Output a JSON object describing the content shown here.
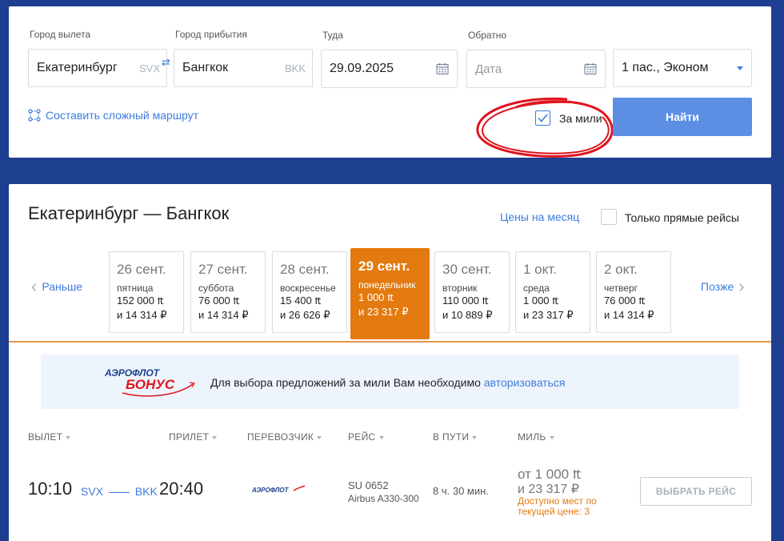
{
  "search": {
    "from_label": "Город вылета",
    "from_value": "Екатеринбург",
    "from_code": "SVX",
    "to_label": "Город прибытия",
    "to_value": "Бангкок",
    "to_code": "BKK",
    "depart_label": "Туда",
    "depart_value": "29.09.2025",
    "return_label": "Обратно",
    "return_placeholder": "Дата",
    "passengers_value": "1 пас., Эконом",
    "complex_route_link": "Составить сложный маршрут",
    "miles_label": "За мили",
    "miles_checked": true,
    "find_button": "Найти",
    "accent_color": "#3d7be0",
    "annotation_color": "#e0141e"
  },
  "results": {
    "title": "Екатеринбург — Бангкок",
    "month_prices_link": "Цены на месяц",
    "direct_only_label": "Только прямые рейсы",
    "direct_only_checked": false,
    "prev_label": "Раньше",
    "next_label": "Позже",
    "days": [
      {
        "date": "26 сент.",
        "weekday": "пятница",
        "miles": "152 000",
        "rub": "и 14 314 ₽"
      },
      {
        "date": "27 сент.",
        "weekday": "суббота",
        "miles": "76 000",
        "rub": "и 14 314 ₽"
      },
      {
        "date": "28 сент.",
        "weekday": "воскресенье",
        "miles": "15 400",
        "rub": "и 26 626 ₽"
      },
      {
        "date": "29 сент.",
        "weekday": "понедельник",
        "miles": "1 000",
        "rub": "и 23 317 ₽",
        "selected": true
      },
      {
        "date": "30 сент.",
        "weekday": "вторник",
        "miles": "110 000",
        "rub": "и 10 889 ₽"
      },
      {
        "date": "1 окт.",
        "weekday": "среда",
        "miles": "1 000",
        "rub": "и 23 317 ₽"
      },
      {
        "date": "2 окт.",
        "weekday": "четверг",
        "miles": "76 000",
        "rub": "и 14 314 ₽"
      }
    ],
    "miles_symbol": "₶",
    "selected_color": "#e37a0f",
    "banner": {
      "logo_line1": "АЭРОФЛОТ",
      "logo_line2": "БОНУС",
      "text": "Для выбора предложений за мили Вам необходимо",
      "link": "авторизоваться"
    },
    "columns": [
      "ВЫЛЕТ",
      "ПРИЛЕТ",
      "ПЕРЕВОЗЧИК",
      "РЕЙС",
      "В ПУТИ",
      "МИЛЬ"
    ],
    "flight": {
      "dep_time": "10:10",
      "dep_code": "SVX",
      "arr_code": "BKK",
      "arr_time": "20:40",
      "carrier_logo_text": "АЭРОФЛОТ",
      "flight_no": "SU 0652",
      "aircraft": "Airbus A330-300",
      "duration": "8 ч. 30 мин.",
      "price_from": "от 1 000",
      "price_rub": "и 23 317 ₽",
      "seats_note": "Доступно мест по текущей цене: 3",
      "select_button": "ВЫБРАТЬ РЕЙС"
    }
  }
}
